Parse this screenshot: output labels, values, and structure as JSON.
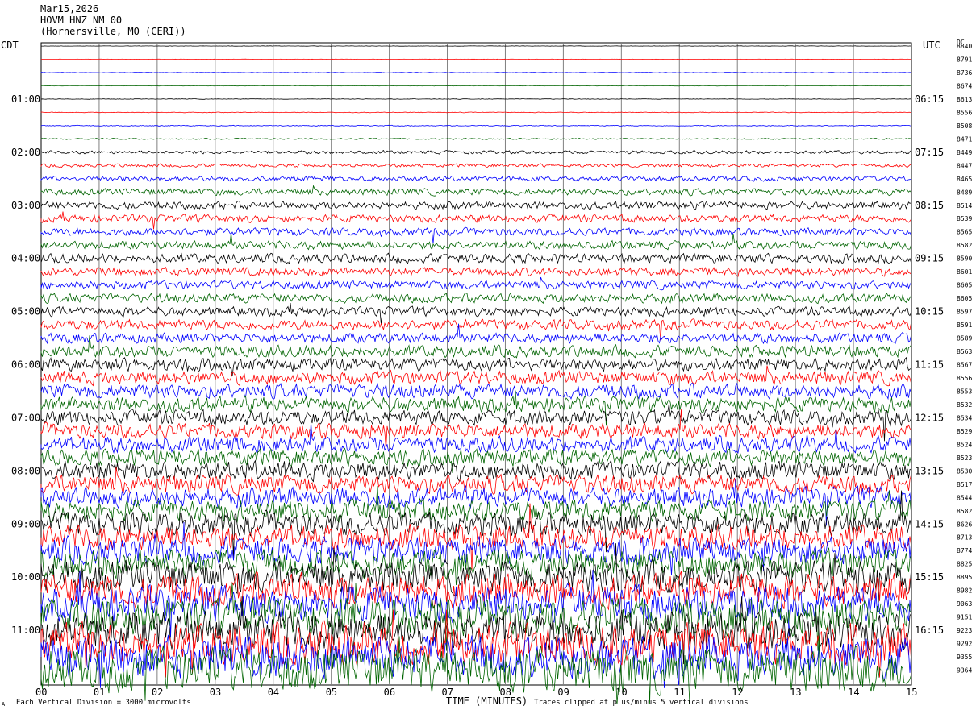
{
  "header": {
    "date": "Mar15,2026",
    "station": "HOVM HNZ NM 00",
    "location": "(Hornersville, MO (CERI))"
  },
  "left_tz": "CDT",
  "right_tz": "UTC",
  "dc_header": "DC",
  "footer": {
    "left_mark": "A",
    "scale_note": "Each Vertical Division = 3000 microvolts",
    "clip_note": "Traces clipped at plus/minus 5 vertical divisions"
  },
  "colors": {
    "trace_cycle": [
      "#000000",
      "#ff0000",
      "#0000ff",
      "#006400"
    ],
    "grid": "#808080"
  },
  "chart_data": {
    "type": "line",
    "title": "",
    "xlabel": "TIME (MINUTES)",
    "xlim": [
      0,
      15
    ],
    "x_ticks": [
      "00",
      "01",
      "02",
      "03",
      "04",
      "05",
      "06",
      "07",
      "08",
      "09",
      "10",
      "11",
      "12",
      "13",
      "14",
      "15"
    ],
    "row_count": 48,
    "left_hour_labels": [
      {
        "row": 4,
        "text": "01:00"
      },
      {
        "row": 8,
        "text": "02:00"
      },
      {
        "row": 12,
        "text": "03:00"
      },
      {
        "row": 16,
        "text": "04:00"
      },
      {
        "row": 20,
        "text": "05:00"
      },
      {
        "row": 24,
        "text": "06:00"
      },
      {
        "row": 28,
        "text": "07:00"
      },
      {
        "row": 32,
        "text": "08:00"
      },
      {
        "row": 36,
        "text": "09:00"
      },
      {
        "row": 40,
        "text": "10:00"
      },
      {
        "row": 44,
        "text": "11:00"
      }
    ],
    "right_hour_labels": [
      {
        "row": 4,
        "text": "06:15"
      },
      {
        "row": 8,
        "text": "07:15"
      },
      {
        "row": 12,
        "text": "08:15"
      },
      {
        "row": 16,
        "text": "09:15"
      },
      {
        "row": 20,
        "text": "10:15"
      },
      {
        "row": 24,
        "text": "11:15"
      },
      {
        "row": 28,
        "text": "12:15"
      },
      {
        "row": 32,
        "text": "13:15"
      },
      {
        "row": 36,
        "text": "14:15"
      },
      {
        "row": 40,
        "text": "15:15"
      },
      {
        "row": 44,
        "text": "16:15"
      }
    ],
    "dc_offsets": [
      8840,
      8791,
      8736,
      8674,
      8613,
      8556,
      8508,
      8471,
      8449,
      8447,
      8465,
      8489,
      8514,
      8539,
      8565,
      8582,
      8590,
      8601,
      8605,
      8605,
      8597,
      8591,
      8589,
      8563,
      8567,
      8556,
      8553,
      8532,
      8534,
      8529,
      8524,
      8523,
      8530,
      8517,
      8544,
      8582,
      8626,
      8713,
      8774,
      8825,
      8895,
      8982,
      9063,
      9151,
      9223,
      9292,
      9355,
      9364
    ],
    "trace_activity": [
      0.02,
      0.02,
      0.03,
      0.03,
      0.03,
      0.04,
      0.05,
      0.08,
      0.2,
      0.2,
      0.3,
      0.4,
      0.45,
      0.45,
      0.45,
      0.5,
      0.55,
      0.5,
      0.5,
      0.55,
      0.55,
      0.6,
      0.6,
      0.7,
      0.75,
      0.8,
      0.85,
      0.9,
      0.9,
      0.9,
      0.95,
      1.0,
      1.1,
      1.1,
      1.2,
      1.3,
      1.4,
      1.5,
      1.6,
      1.7,
      1.9,
      2.0,
      2.1,
      2.2,
      2.3,
      2.4,
      2.5,
      2.6
    ]
  }
}
